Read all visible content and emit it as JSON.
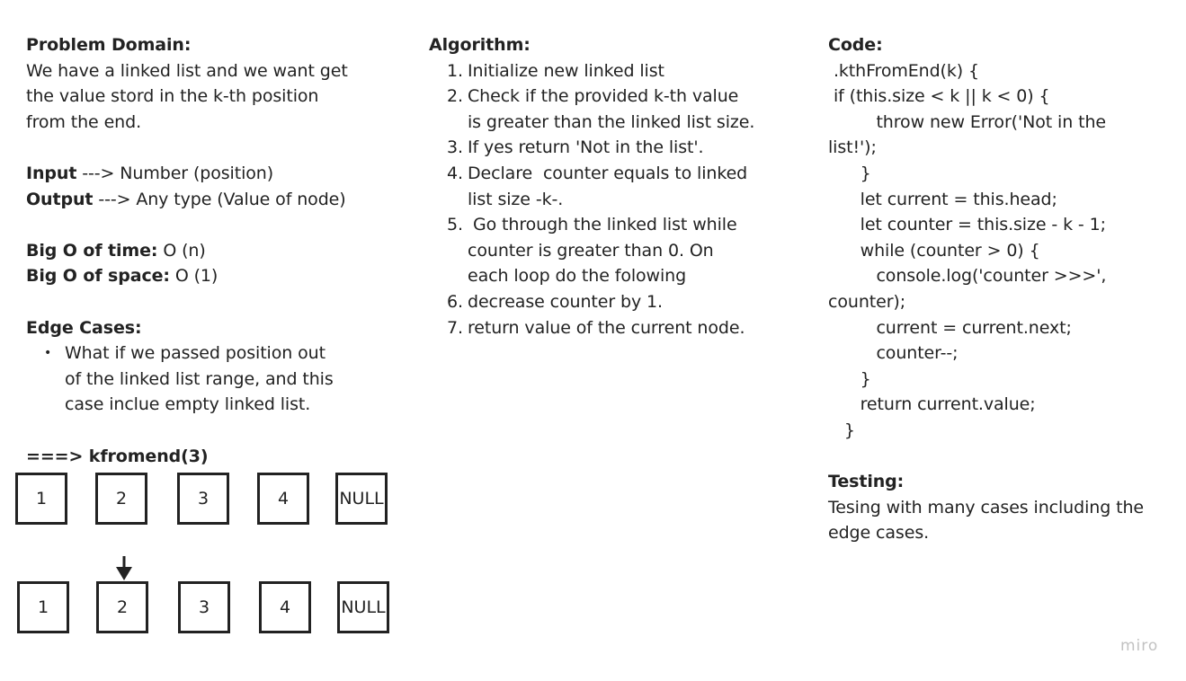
{
  "problem_domain": {
    "heading": "Problem Domain:",
    "lines": [
      "We have a linked list and we want get",
      "the value stord in the k-th position",
      "from the end."
    ]
  },
  "io": {
    "input_label": "Input",
    "input_text": " ---> Number (position)",
    "output_label": "Output",
    "output_text": " ---> Any type (Value of node)"
  },
  "big_o": {
    "time_label": "Big O of time:",
    "time_value": " O (n)",
    "space_label": "Big O of space:",
    "space_value": " O (1)"
  },
  "edge_cases": {
    "heading": "Edge Cases:",
    "bullet": "•",
    "lines": [
      "What if we passed position out",
      "of the linked list range, and this",
      "case inclue empty linked list."
    ]
  },
  "example": {
    "call": "===> kfromend(3)",
    "row1": [
      "1",
      "2",
      "3",
      "4",
      "NULL"
    ],
    "row2": [
      "1",
      "2",
      "3",
      "4",
      "NULL"
    ],
    "pointer_index": 1
  },
  "algorithm": {
    "heading": "Algorithm:",
    "steps": [
      {
        "num": "1.",
        "lines": [
          "Initialize new linked list"
        ]
      },
      {
        "num": "2.",
        "lines": [
          "Check if the provided k-th value",
          "is greater than the linked list size."
        ]
      },
      {
        "num": "3.",
        "lines": [
          "If yes return 'Not in the list'."
        ]
      },
      {
        "num": "4.",
        "lines": [
          "Declare  counter equals to linked",
          "list size -k-."
        ]
      },
      {
        "num": "5.",
        "lines": [
          " Go through the linked list while",
          "counter is greater than 0. On",
          "each loop do the folowing"
        ]
      },
      {
        "num": "6.",
        "lines": [
          "decrease counter by 1."
        ]
      },
      {
        "num": "7.",
        "lines": [
          "return value of the current node."
        ]
      }
    ]
  },
  "code": {
    "heading": "Code:",
    "lines": [
      " .kthFromEnd(k) {",
      " if (this.size < k || k < 0) {",
      "         throw new Error('Not in the",
      "list!');",
      "      }",
      "      let current = this.head;",
      "      let counter = this.size - k - 1;",
      "      while (counter > 0) {",
      "         console.log('counter >>>',",
      "counter);",
      "         current = current.next;",
      "         counter--;",
      "      }",
      "      return current.value;",
      "   }"
    ]
  },
  "testing": {
    "heading": "Testing:",
    "lines": [
      "Tesing with many cases including the",
      "edge cases."
    ]
  },
  "watermark": "miro",
  "colors": {
    "text": "#222222",
    "box_border": "#222222",
    "watermark": "#c2c2c2",
    "background": "#ffffff"
  }
}
